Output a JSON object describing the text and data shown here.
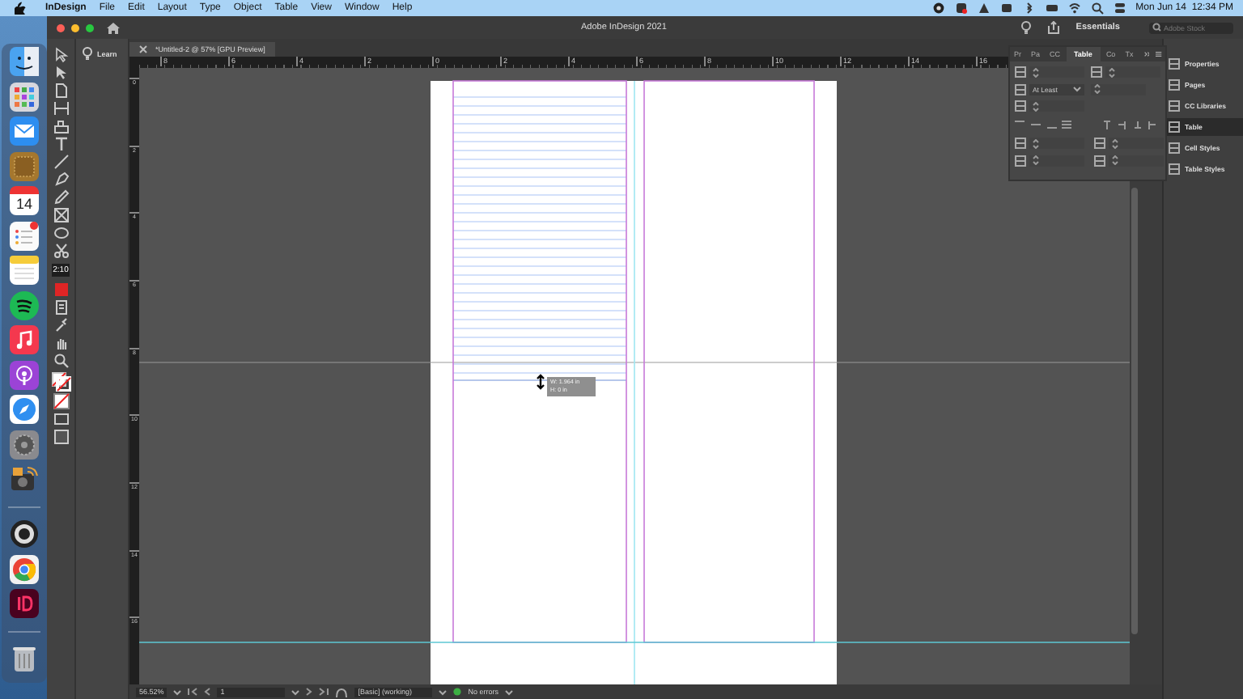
{
  "menu_bar": {
    "app": "InDesign",
    "items": [
      "File",
      "Edit",
      "Layout",
      "Type",
      "Object",
      "Table",
      "View",
      "Window",
      "Help"
    ],
    "clock": "Mon Jun 14  12:34 PM"
  },
  "dock": {
    "calendar_day": "14"
  },
  "window": {
    "title": "Adobe InDesign 2021",
    "document_tab": "*Untitled-2 @ 57% [GPU Preview]",
    "learn": "Learn",
    "workspace": "Essentials",
    "search": {
      "placeholder": "Adobe Stock"
    },
    "timer": "2:10"
  },
  "ruler": {
    "horizontal": [
      "8",
      "6",
      "4",
      "2",
      "0",
      "2",
      "4",
      "6",
      "8",
      "10",
      "12",
      "14",
      "16"
    ],
    "vertical": [
      "0",
      "2",
      "4",
      "6",
      "8",
      "10",
      "12",
      "14",
      "16"
    ]
  },
  "tooltip": [
    "W: 1.964 in",
    "H: 0 in"
  ],
  "table_panel": {
    "tabs": [
      {
        "label": "Pr",
        "selected": false
      },
      {
        "label": "Pa",
        "selected": false
      },
      {
        "label": "CC",
        "selected": false
      },
      {
        "label": "Table",
        "selected": true
      },
      {
        "label": "Co",
        "selected": false
      },
      {
        "label": "Tx",
        "selected": false
      }
    ],
    "row_height": "At Least"
  },
  "side_panel": {
    "items": [
      {
        "label": "Properties",
        "selected": false
      },
      {
        "label": "Pages",
        "selected": false
      },
      {
        "label": "CC Libraries",
        "selected": false
      },
      {
        "label": "Table",
        "selected": true
      },
      {
        "label": "Cell Styles",
        "selected": false
      },
      {
        "label": "Table Styles",
        "selected": false
      }
    ]
  },
  "status_bar": {
    "zoom": "56.52%",
    "page": "1",
    "style": "[Basic] (working)",
    "preflight": "No errors"
  }
}
